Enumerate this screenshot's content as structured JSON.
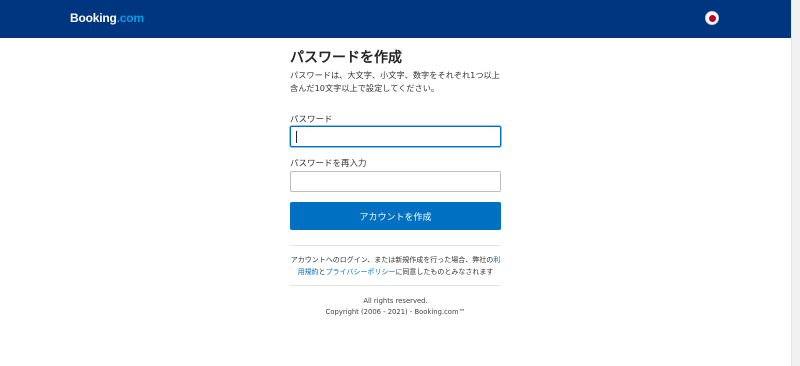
{
  "header": {
    "brand_main": "Booking",
    "brand_suffix": ".com",
    "language_flag_icon": "japan-flag-icon",
    "colors": {
      "background": "#003580",
      "brand_suffix": "#009fe3"
    }
  },
  "form": {
    "title": "パスワードを作成",
    "description": "パスワードは、大文字、小文字、数字をそれぞれ1つ以上含んだ10文字以上で設定してください。",
    "password_label": "パスワード",
    "password_value": "",
    "confirm_label": "パスワードを再入力",
    "confirm_value": "",
    "submit_label": "アカウントを作成",
    "colors": {
      "primary": "#0071c2"
    }
  },
  "terms": {
    "prefix": "アカウントへのログイン、または新規作成を行った場合、弊社の",
    "terms_link": "利用規約",
    "joiner": "と",
    "privacy_link": "プライバシーポリシー",
    "suffix": "に同意したものとみなされます"
  },
  "footer": {
    "rights": "All rights reserved.",
    "copyright": "Copyright (2006 - 2021) - Booking.com™"
  }
}
